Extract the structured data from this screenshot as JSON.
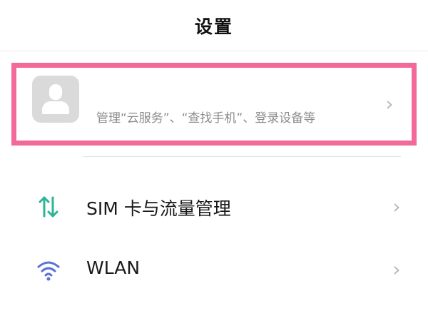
{
  "header": {
    "title": "设置"
  },
  "account": {
    "avatar_icon": "user-avatar-icon",
    "description": "管理“云服务”、“查找手机”、登录设备等",
    "chevron_icon": "chevron-right-icon",
    "highlight_color": "#f2699a"
  },
  "settings": {
    "items": [
      {
        "label": "SIM 卡与流量管理",
        "icon": "sim-data-arrows-icon",
        "icon_color": "#2bb594"
      },
      {
        "label": "WLAN",
        "icon": "wifi-icon",
        "icon_color": "#5a6fd8"
      }
    ]
  },
  "chevron_glyph": "›"
}
